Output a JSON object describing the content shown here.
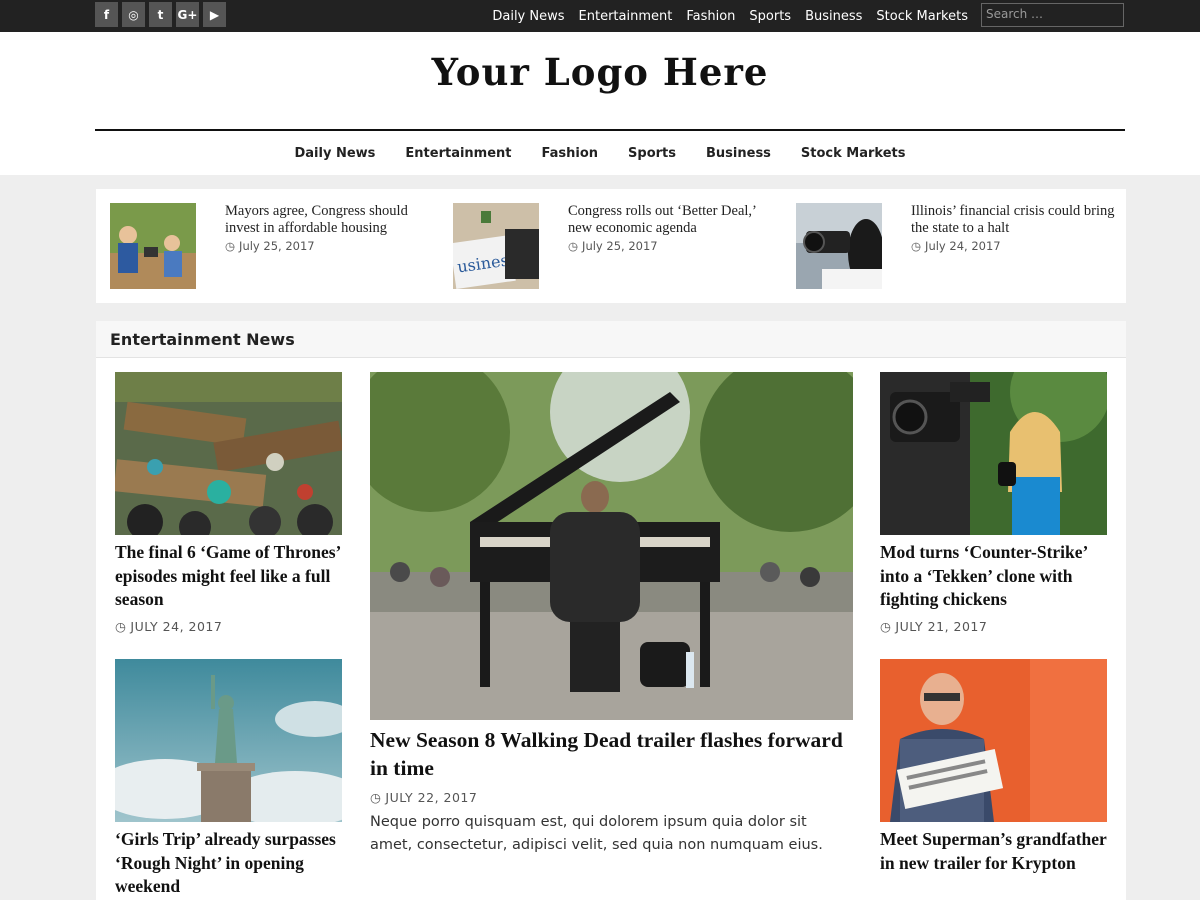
{
  "social": [
    {
      "icon": "facebook-icon",
      "glyph": "f"
    },
    {
      "icon": "instagram-icon",
      "glyph": "◎"
    },
    {
      "icon": "twitter-icon",
      "glyph": "t"
    },
    {
      "icon": "google-plus-icon",
      "glyph": "G+"
    },
    {
      "icon": "youtube-icon",
      "glyph": "▶"
    }
  ],
  "topnav": [
    "Daily News",
    "Entertainment",
    "Fashion",
    "Sports",
    "Business",
    "Stock Markets"
  ],
  "search": {
    "placeholder": "Search …"
  },
  "logo": "Your Logo Here",
  "mainnav": [
    "Daily News",
    "Entertainment",
    "Fashion",
    "Sports",
    "Business",
    "Stock Markets"
  ],
  "featured": [
    {
      "title": "Mayors agree, Congress should invest in affordable housing",
      "date": "July 25, 2017"
    },
    {
      "title": "Congress rolls out ‘Better Deal,’ new economic agenda",
      "date": "July 25, 2017"
    },
    {
      "title": "Illinois’ financial crisis could bring the state to a halt",
      "date": "July 24, 2017"
    }
  ],
  "section": {
    "title": "Entertainment News",
    "left": [
      {
        "title": "The final 6 ‘Game of Thrones’ episodes might feel like a full season",
        "date": "JULY 24, 2017"
      },
      {
        "title": "‘Girls Trip’ already surpasses ‘Rough Night’ in opening weekend"
      }
    ],
    "center": {
      "title": "New Season 8 Walking Dead trailer flashes forward in time",
      "date": "JULY 22, 2017",
      "excerpt": "Neque porro quisquam est, qui dolorem ipsum quia dolor sit amet, consectetur, adipisci velit, sed quia non numquam eius."
    },
    "right": [
      {
        "title": "Mod turns ‘Counter-Strike’ into a ‘Tekken’ clone with fighting chickens",
        "date": "JULY 21, 2017"
      },
      {
        "title": "Meet Superman’s grandfather in new trailer for Krypton"
      }
    ]
  },
  "colors": {
    "topbar": "#222222",
    "social_bg": "#555555",
    "page_bg": "#eeeeee",
    "text": "#111111"
  }
}
